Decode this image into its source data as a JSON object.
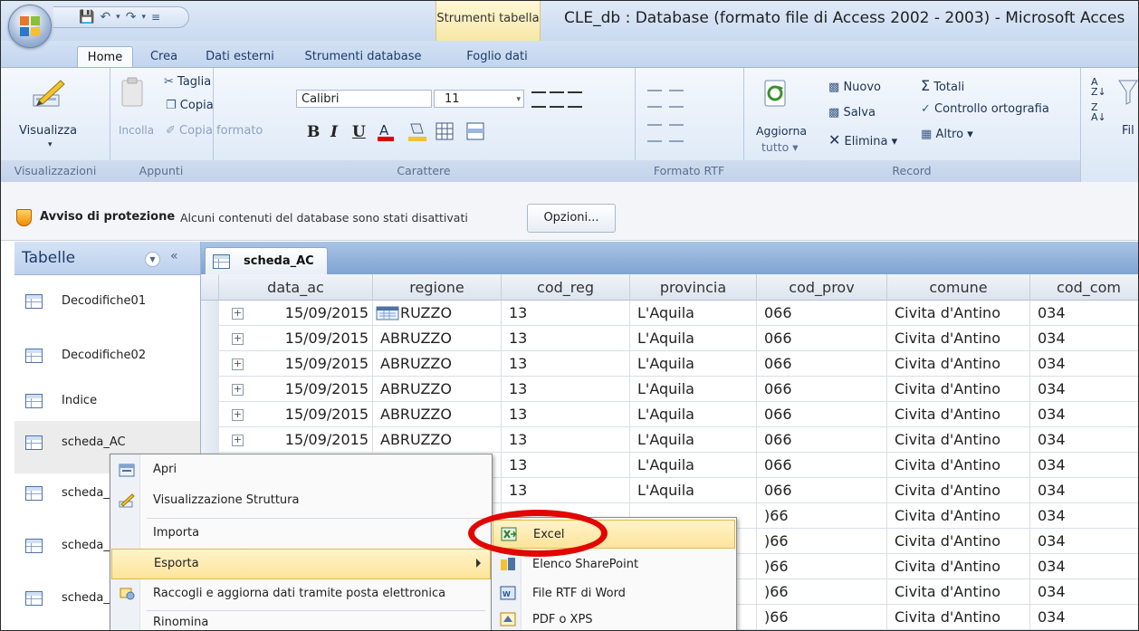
{
  "title_bar": {
    "context_tab": "Strumenti tabella",
    "window_title": "CLE_db : Database (formato file di Access 2002 - 2003) - Microsoft Acces"
  },
  "tabs": [
    "Home",
    "Crea",
    "Dati esterni",
    "Strumenti database",
    "Foglio dati"
  ],
  "ribbon": {
    "views": {
      "button": "Visualizza",
      "group": "Visualizzazioni"
    },
    "clipboard": {
      "paste": "Incolla",
      "cut": "Taglia",
      "copy": "Copia",
      "format_painter": "Copia formato",
      "group": "Appunti"
    },
    "font": {
      "name": "Calibri",
      "size": "11",
      "bold": "B",
      "italic": "I",
      "underline": "U",
      "group": "Carattere"
    },
    "rtf": {
      "group": "Formato RTF"
    },
    "records": {
      "refresh_line1": "Aggiorna",
      "refresh_line2": "tutto",
      "new": "Nuovo",
      "save": "Salva",
      "delete": "Elimina",
      "totals": "Totali",
      "spelling": "Controllo ortografia",
      "more": "Altro",
      "group": "Record"
    },
    "filter": {
      "truncated": "Fil"
    }
  },
  "security_bar": {
    "title": "Avviso di protezione",
    "message": "Alcuni contenuti del database sono stati disattivati",
    "button": "Opzioni..."
  },
  "nav_pane": {
    "title": "Tabelle",
    "items": [
      {
        "label": "Decodifiche01"
      },
      {
        "label": "Decodifiche02"
      },
      {
        "label": "Indice"
      },
      {
        "label": "scheda_AC"
      },
      {
        "label": "scheda_"
      },
      {
        "label": "scheda_"
      },
      {
        "label": "scheda_"
      }
    ]
  },
  "datasheet": {
    "tab_label": "scheda_AC",
    "columns": [
      "data_ac",
      "regione",
      "cod_reg",
      "provincia",
      "cod_prov",
      "comune",
      "cod_com"
    ],
    "rows": [
      [
        "15/09/2015",
        "RUZZO",
        "13",
        "L'Aquila",
        "066",
        "Civita d'Antino",
        "034"
      ],
      [
        "15/09/2015",
        "ABRUZZO",
        "13",
        "L'Aquila",
        "066",
        "Civita d'Antino",
        "034"
      ],
      [
        "15/09/2015",
        "ABRUZZO",
        "13",
        "L'Aquila",
        "066",
        "Civita d'Antino",
        "034"
      ],
      [
        "15/09/2015",
        "ABRUZZO",
        "13",
        "L'Aquila",
        "066",
        "Civita d'Antino",
        "034"
      ],
      [
        "15/09/2015",
        "ABRUZZO",
        "13",
        "L'Aquila",
        "066",
        "Civita d'Antino",
        "034"
      ],
      [
        "15/09/2015",
        "ABRUZZO",
        "13",
        "L'Aquila",
        "066",
        "Civita d'Antino",
        "034"
      ],
      [
        "",
        "",
        "13",
        "L'Aquila",
        "066",
        "Civita d'Antino",
        "034"
      ],
      [
        "",
        "",
        "13",
        "L'Aquila",
        "066",
        "Civita d'Antino",
        "034"
      ],
      [
        "",
        "",
        "",
        "",
        ")66",
        "Civita d'Antino",
        "034"
      ],
      [
        "",
        "",
        "",
        "",
        ")66",
        "Civita d'Antino",
        "034"
      ],
      [
        "",
        "",
        "",
        "",
        ")66",
        "Civita d'Antino",
        "034"
      ],
      [
        "",
        "",
        "",
        "",
        ")66",
        "Civita d'Antino",
        "034"
      ],
      [
        "",
        "",
        "",
        "",
        ")66",
        "Civita d'Antino",
        "034"
      ]
    ]
  },
  "context_menu": {
    "items": [
      {
        "label": "Apri",
        "icon": "open-icon"
      },
      {
        "label": "Visualizzazione Struttura",
        "icon": "design-view-icon"
      },
      {
        "label": "Importa",
        "icon": ""
      },
      {
        "label": "Esporta",
        "icon": "",
        "submenu": true
      },
      {
        "label": "Raccogli e aggiorna dati tramite posta elettronica",
        "icon": "email-collect-icon"
      },
      {
        "label": "Rinomina",
        "icon": ""
      }
    ],
    "export_submenu": [
      {
        "label": "Excel",
        "icon": "excel-icon"
      },
      {
        "label": "Elenco SharePoint",
        "icon": "sharepoint-icon"
      },
      {
        "label": "File RTF di Word",
        "icon": "word-icon"
      },
      {
        "label": "PDF o XPS",
        "icon": "pdf-icon"
      }
    ]
  },
  "colors": {
    "highlight_circle": "#e10600",
    "menu_highlight": "#fde49a",
    "ribbon": "#dbe7f6"
  }
}
